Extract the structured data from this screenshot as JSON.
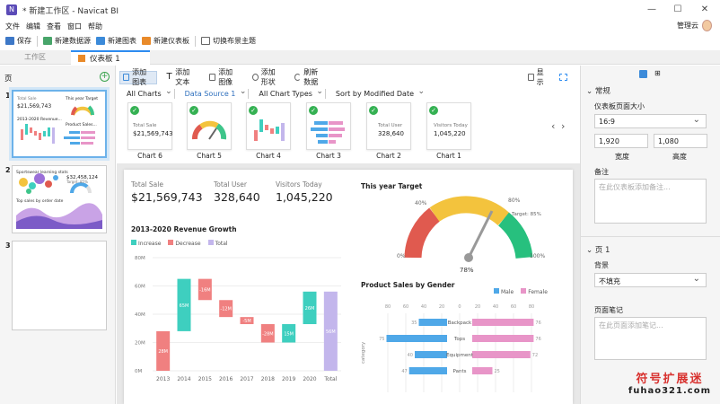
{
  "window": {
    "title": "* 新建工作区 - Navicat BI",
    "min": "—",
    "max": "☐",
    "close": "✕"
  },
  "menu": [
    "文件",
    "编辑",
    "查看",
    "窗口",
    "帮助"
  ],
  "user": {
    "name": "管理云"
  },
  "toolbar": {
    "save": "保存",
    "new_source": "新建数据源",
    "new_chart": "新建图表",
    "new_dashboard": "新建仪表板",
    "switch_theme": "切换布景主题"
  },
  "tabs": {
    "workspace": "工作区",
    "dashboard": "仪表板 1"
  },
  "pages": {
    "header": "页",
    "add": "+",
    "items": [
      {
        "num": "1"
      },
      {
        "num": "2"
      },
      {
        "num": "3"
      }
    ]
  },
  "thumb1": {
    "t1": "Total Sale",
    "v1": "$21,569,743",
    "t2": "This year Target",
    "t3": "2013-2020 Revenue...",
    "t4": "Product Sales..."
  },
  "thumb2": {
    "t1": "Sportswear learning stats",
    "t2": "Top sales by order date",
    "t3": "$32,458,124",
    "t4": "Target: 85%"
  },
  "ctoolbar": {
    "add_chart": "添加图表",
    "add_text": "添加文本",
    "add_image": "添加图像",
    "add_shape": "添加形状",
    "refresh": "刷新数据",
    "display": "显示"
  },
  "filters": {
    "charts": "All Charts",
    "source": "Data Source 1",
    "types": "All Chart Types",
    "sort": "Sort by Modified Date"
  },
  "gallery": [
    {
      "label": "Chart 6",
      "t": "Total Sale",
      "v": "$21,569,743"
    },
    {
      "label": "Chart 5"
    },
    {
      "label": "Chart 4"
    },
    {
      "label": "Chart 3"
    },
    {
      "label": "Chart 2",
      "t": "Total User",
      "v": "328,640"
    },
    {
      "label": "Chart 1",
      "t": "Visitors Today",
      "v": "1,045,220"
    }
  ],
  "kpis": [
    {
      "label": "Total Sale",
      "value": "$21,569,743"
    },
    {
      "label": "Total User",
      "value": "328,640"
    },
    {
      "label": "Visitors Today",
      "value": "1,045,220"
    }
  ],
  "waterfall": {
    "title": "2013-2020 Revenue Growth",
    "legend": [
      "Increase",
      "Decrease",
      "Total"
    ]
  },
  "gauge": {
    "title": "This year Target",
    "value": "78%",
    "target": "Target: 85%",
    "ticks": [
      "0%",
      "40%",
      "80%",
      "100%"
    ]
  },
  "bars": {
    "title": "Product Sales by Gender",
    "legend": [
      "Male",
      "Female"
    ],
    "ylabel": "category"
  },
  "chart_data": [
    {
      "type": "bar",
      "title": "2013-2020 Revenue Growth",
      "variant": "waterfall",
      "categories": [
        "2013",
        "2014",
        "2015",
        "2016",
        "2017",
        "2018",
        "2019",
        "2020",
        "Total"
      ],
      "y_ticks": [
        "0M",
        "20M",
        "40M",
        "60M",
        "80M"
      ],
      "ylim": [
        0,
        80
      ],
      "series": [
        {
          "name": "Increase",
          "color": "#3ecfbf"
        },
        {
          "name": "Decrease",
          "color": "#f08080"
        },
        {
          "name": "Total",
          "color": "#c3b6ec"
        }
      ],
      "bars": [
        {
          "x": "2013",
          "start": 0,
          "end": 28,
          "label": "28M",
          "kind": "Increase",
          "color": "#f08080"
        },
        {
          "x": "2014",
          "start": 28,
          "end": 65,
          "label": "65M",
          "kind": "Increase"
        },
        {
          "x": "2015",
          "start": 65,
          "end": 50,
          "label": "-16M",
          "kind": "Decrease"
        },
        {
          "x": "2016",
          "start": 50,
          "end": 38,
          "label": "-12M",
          "kind": "Decrease"
        },
        {
          "x": "2017",
          "start": 38,
          "end": 33,
          "label": "-5M",
          "kind": "Decrease"
        },
        {
          "x": "2018",
          "start": 33,
          "end": 20,
          "label": "-28M",
          "kind": "Decrease"
        },
        {
          "x": "2019",
          "start": 20,
          "end": 33,
          "label": "15M",
          "kind": "Increase"
        },
        {
          "x": "2020",
          "start": 33,
          "end": 56,
          "label": "26M",
          "kind": "Increase"
        },
        {
          "x": "Total",
          "start": 0,
          "end": 56,
          "label": "56M",
          "kind": "Total"
        }
      ]
    },
    {
      "type": "gauge",
      "title": "This year Target",
      "value": 78,
      "target": 85,
      "max": 100
    },
    {
      "type": "bar",
      "title": "Product Sales by Gender",
      "orientation": "horizontal",
      "categories": [
        "Backpack",
        "Tops",
        "Equipment",
        "Pants"
      ],
      "x_ticks": [
        "80",
        "60",
        "40",
        "20",
        "0",
        "20",
        "40",
        "60",
        "80"
      ],
      "series": [
        {
          "name": "Male",
          "values": [
            35,
            75,
            40,
            47
          ],
          "labels": [
            "35",
            "75",
            "40",
            "47"
          ],
          "color": "#4fa8e8"
        },
        {
          "name": "Female",
          "values": [
            76,
            76,
            72,
            25
          ],
          "labels": [
            "76",
            "76",
            "72",
            "25"
          ],
          "color": "#e895c8"
        }
      ]
    }
  ],
  "rightpane": {
    "section_general": "常规",
    "size_label": "仪表板页面大小",
    "size_value": "16:9",
    "width": "1,920",
    "height": "1,080",
    "width_label": "宽度",
    "height_label": "高度",
    "notes_label": "备注",
    "notes_ph": "在此仪表板添加备注...",
    "section_page": "页 1",
    "bg_label": "背景",
    "bg_value": "不填充",
    "page_notes_label": "页面笔记",
    "page_notes_ph": "在此页面添加笔记..."
  },
  "watermark": {
    "l1": "符号扩展迷",
    "l2": "fuhao321.com"
  }
}
